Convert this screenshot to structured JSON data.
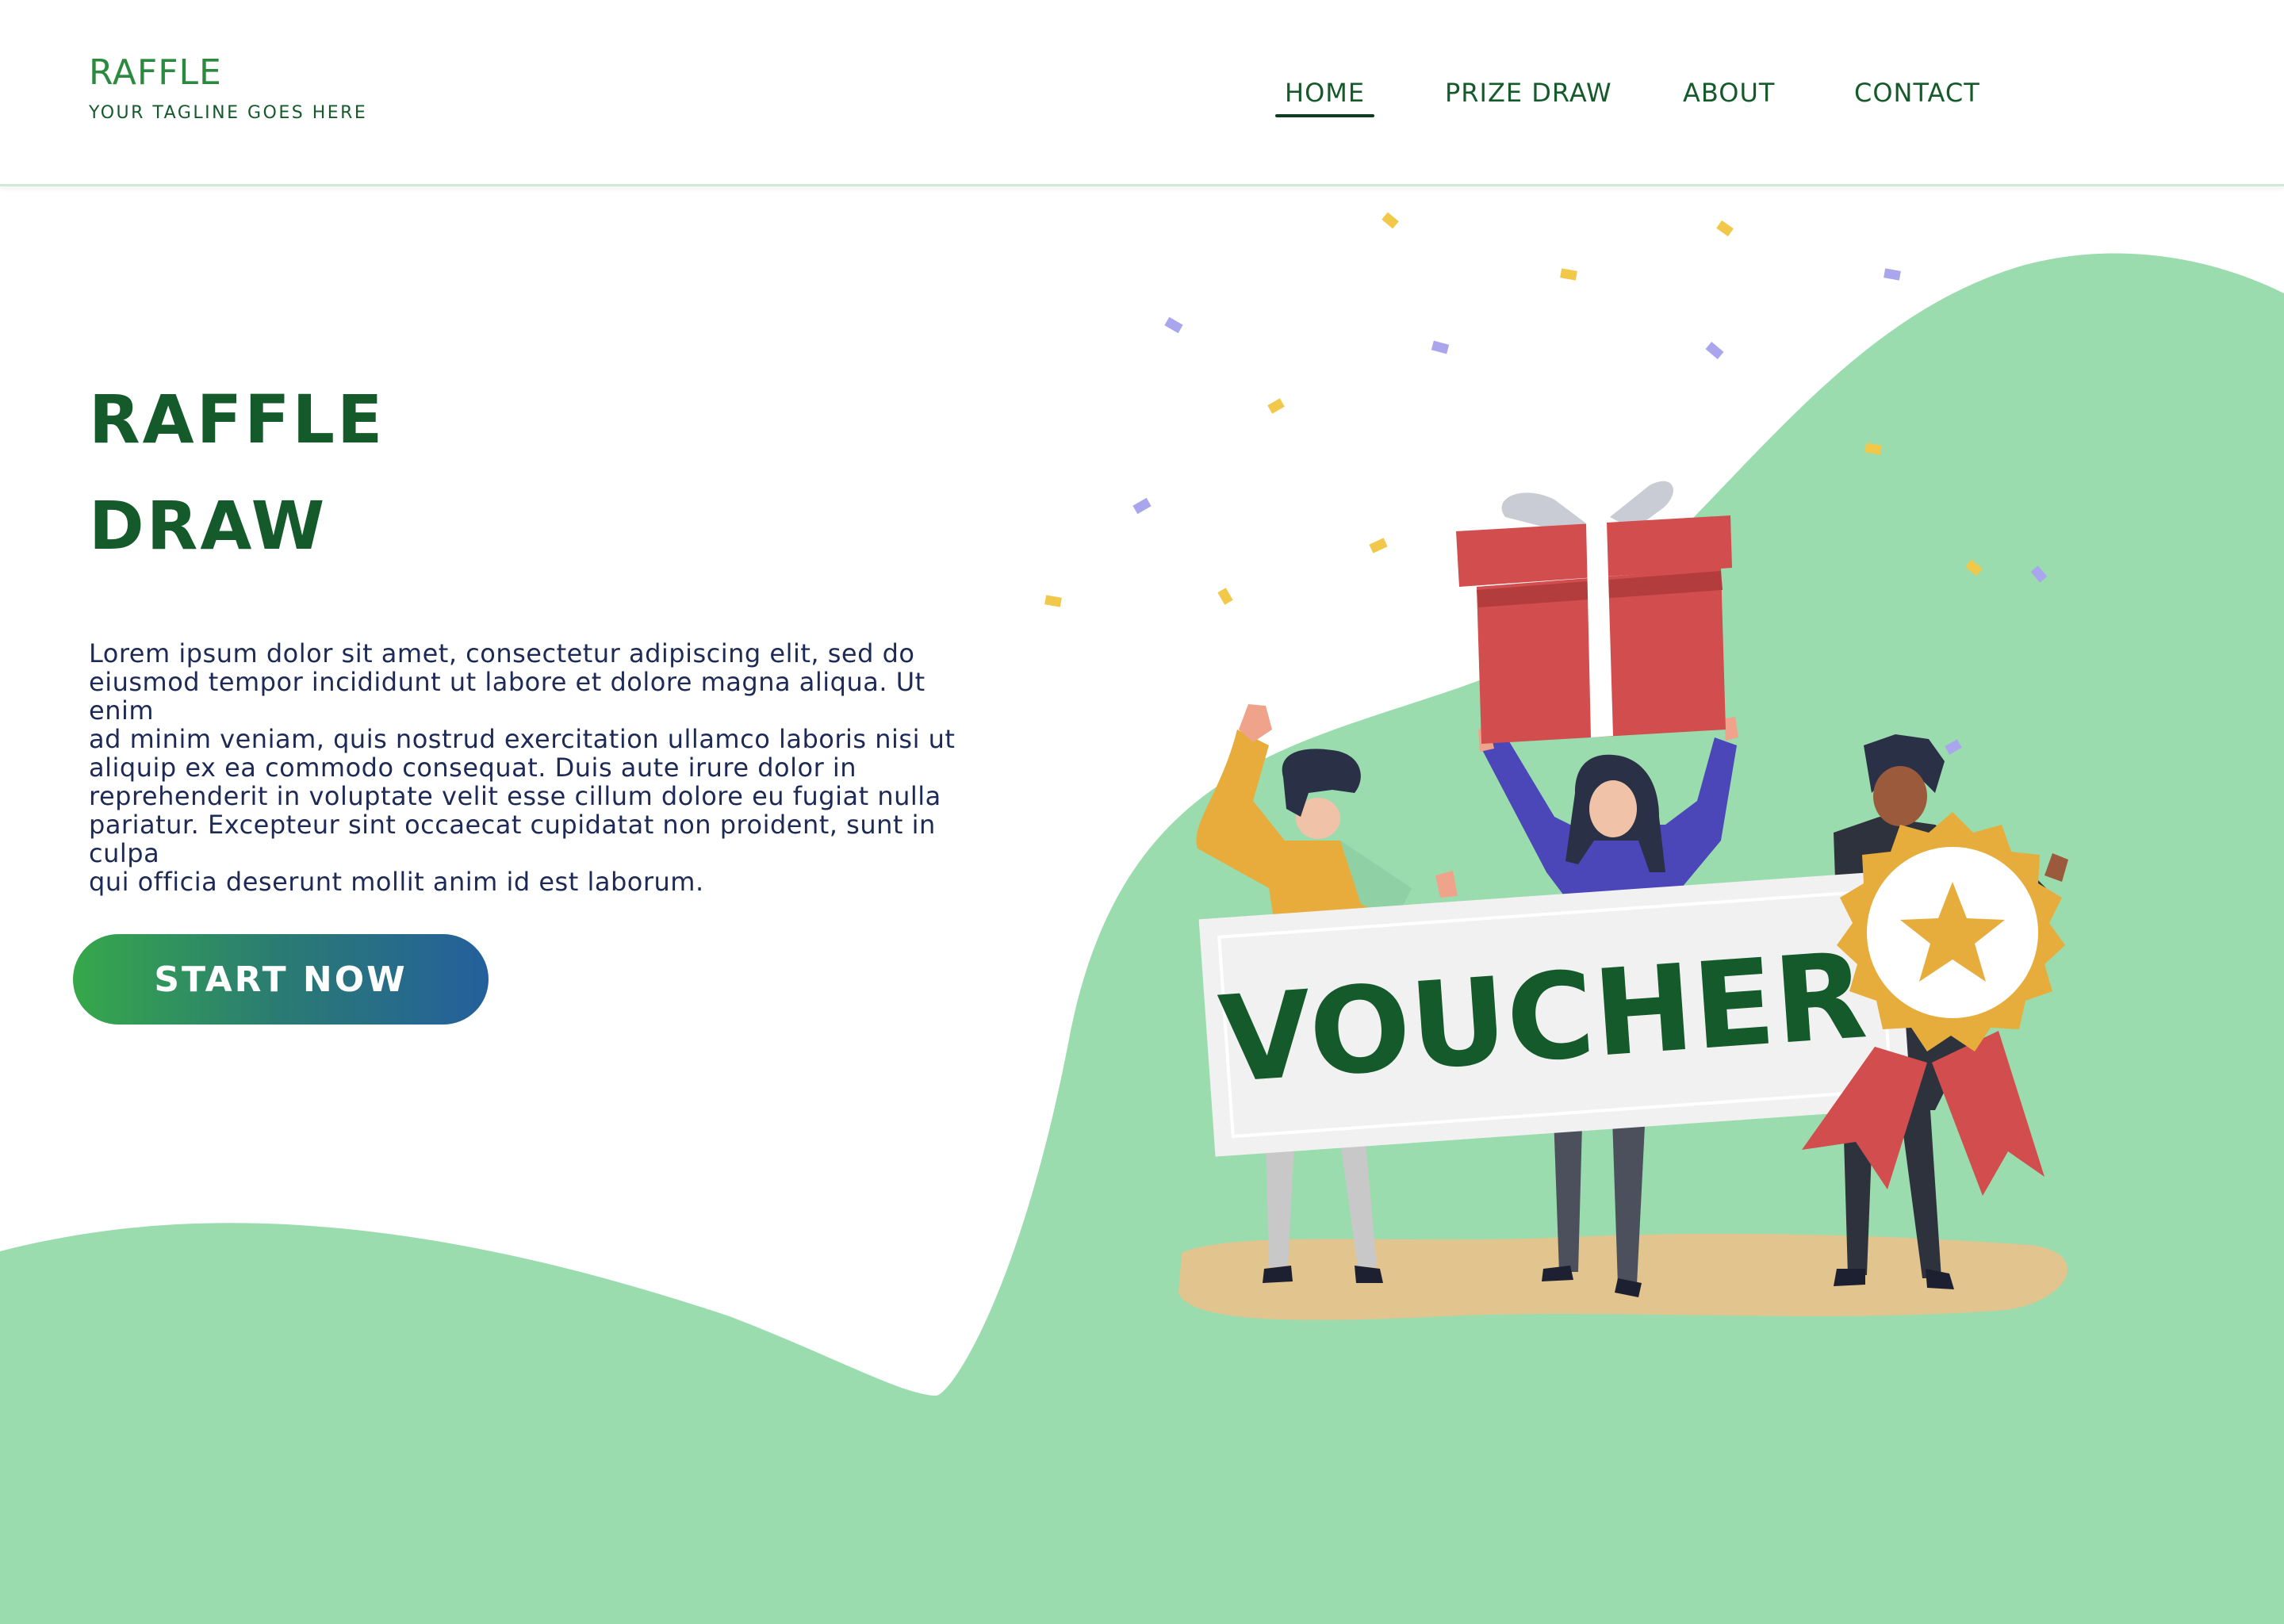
{
  "brand": {
    "name": "RAFFLE",
    "tagline": "YOUR TAGLINE GOES HERE"
  },
  "nav": {
    "items": [
      {
        "label": "HOME",
        "active": true
      },
      {
        "label": "PRIZE DRAW",
        "active": false
      },
      {
        "label": "ABOUT",
        "active": false
      },
      {
        "label": "CONTACT",
        "active": false
      }
    ]
  },
  "hero": {
    "title_line1": "RAFFLE",
    "title_line2": "DRAW",
    "body": "Lorem ipsum dolor sit amet, consectetur adipiscing elit, sed do\neiusmod tempor incididunt ut labore et dolore magna aliqua. Ut enim\nad minim veniam, quis nostrud exercitation ullamco laboris nisi ut\naliquip ex ea commodo consequat. Duis aute irure dolor in\nreprehenderit in voluptate velit esse cillum dolore eu fugiat nulla\npariatur. Excepteur sint occaecat cupidatat non proident, sunt in culpa\nqui officia deserunt mollit anim id est laborum.",
    "cta_label": "START NOW"
  },
  "illustration": {
    "voucher_text": "VOUCHER"
  },
  "colors": {
    "brand_green": "#2b8a3e",
    "dark_green": "#145a2a",
    "wave_green": "#9adcae",
    "gift_red": "#d24d4d",
    "badge_gold": "#e7ad3c",
    "cta_gradient_start": "#36a84a",
    "cta_gradient_end": "#245f9c"
  }
}
